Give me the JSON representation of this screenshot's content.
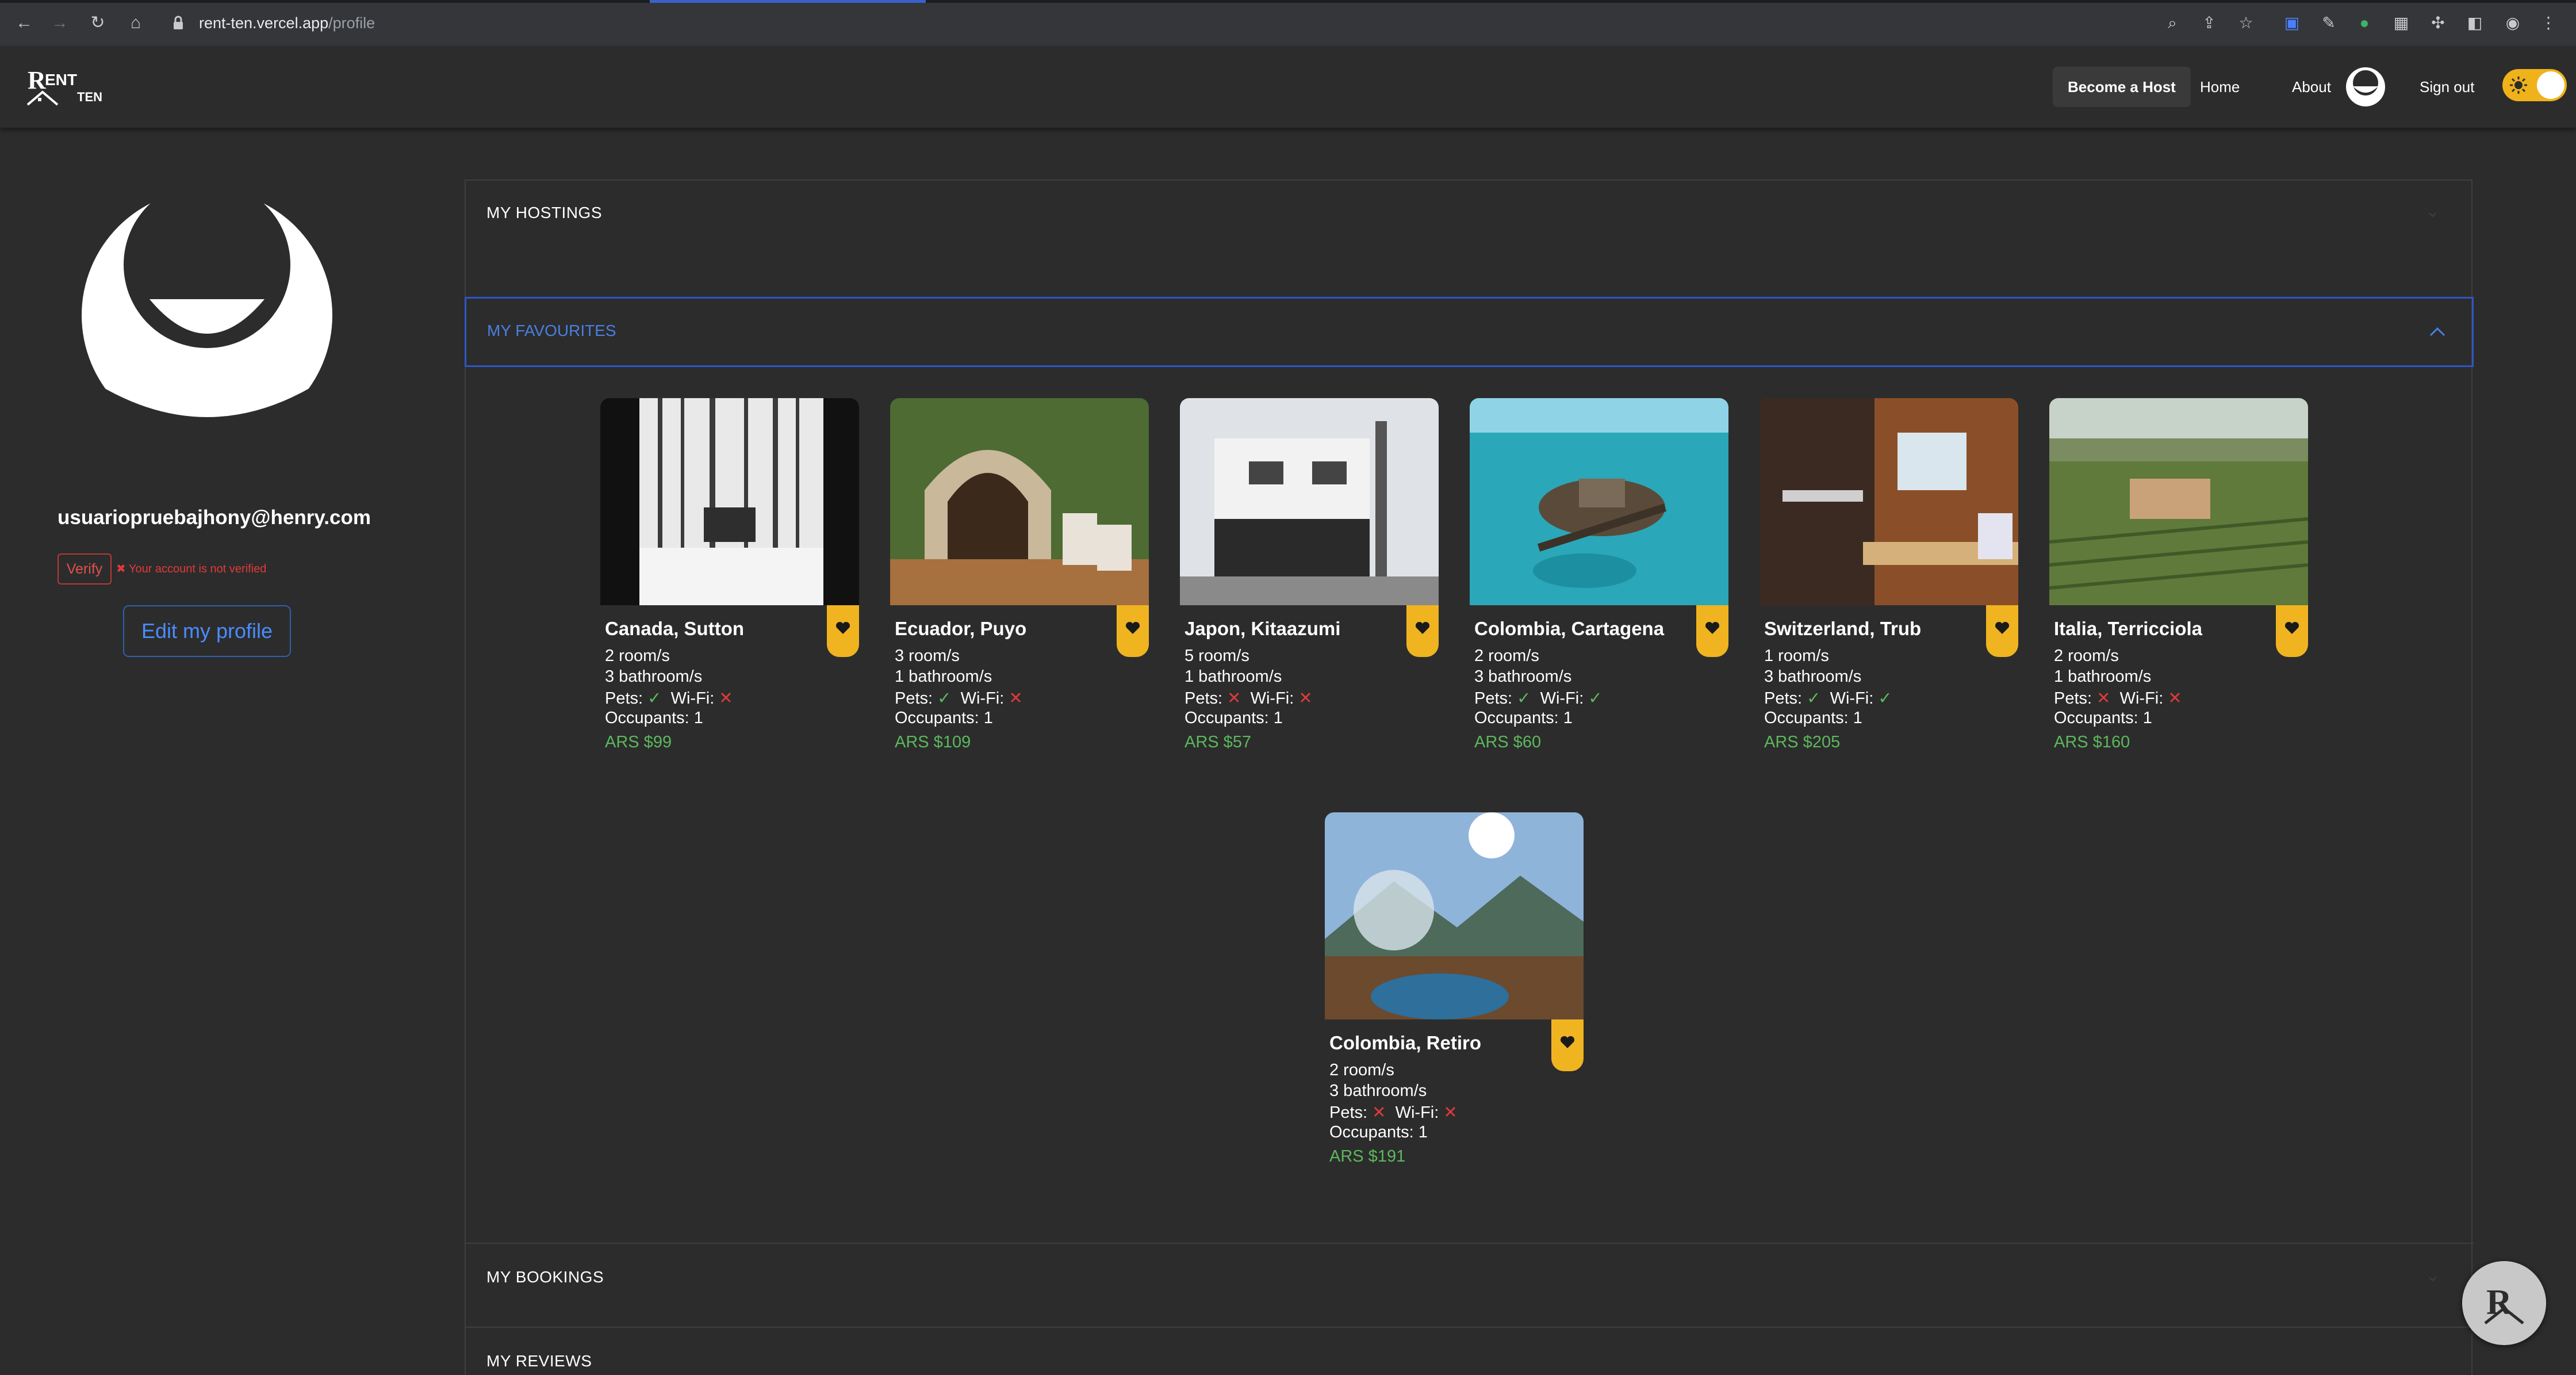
{
  "browser": {
    "url_host": "rent-ten.vercel.app",
    "url_path": "/profile"
  },
  "header": {
    "logo_text": "RENT TEN",
    "nav": {
      "become_host": "Become a Host",
      "home": "Home",
      "about": "About",
      "sign_out": "Sign out"
    }
  },
  "profile": {
    "email": "usuariopruebajhony@henry.com",
    "verify_label": "Verify",
    "verify_message": "✖ Your account is not verified",
    "edit_label": "Edit my profile"
  },
  "sections": {
    "hostings": "MY HOSTINGS",
    "favourites": "MY FAVOURITES",
    "bookings": "MY BOOKINGS",
    "reviews": "MY REVIEWS"
  },
  "favourites": [
    {
      "title": "Canada, Sutton",
      "rooms": "2 room/s",
      "baths": "3 bathroom/s",
      "pets_label": "Pets:",
      "pets": "✓",
      "wifi_label": "Wi-Fi:",
      "wifi": "✕",
      "occupants": "Occupants: 1",
      "price": "ARS $99"
    },
    {
      "title": "Ecuador, Puyo",
      "rooms": "3 room/s",
      "baths": "1 bathroom/s",
      "pets_label": "Pets:",
      "pets": "✓",
      "wifi_label": "Wi-Fi:",
      "wifi": "✕",
      "occupants": "Occupants: 1",
      "price": "ARS $109"
    },
    {
      "title": "Japon, Kitaazumi",
      "rooms": "5 room/s",
      "baths": "1 bathroom/s",
      "pets_label": "Pets:",
      "pets": "✕",
      "wifi_label": "Wi-Fi:",
      "wifi": "✕",
      "occupants": "Occupants: 1",
      "price": "ARS $57"
    },
    {
      "title": "Colombia, Cartagena",
      "rooms": "2 room/s",
      "baths": "3 bathroom/s",
      "pets_label": "Pets:",
      "pets": "✓",
      "wifi_label": "Wi-Fi:",
      "wifi": "✓",
      "occupants": "Occupants: 1",
      "price": "ARS $60"
    },
    {
      "title": "Switzerland, Trub",
      "rooms": "1 room/s",
      "baths": "3 bathroom/s",
      "pets_label": "Pets:",
      "pets": "✓",
      "wifi_label": "Wi-Fi:",
      "wifi": "✓",
      "occupants": "Occupants: 1",
      "price": "ARS $205"
    },
    {
      "title": "Italia, Terricciola",
      "rooms": "2 room/s",
      "baths": "1 bathroom/s",
      "pets_label": "Pets:",
      "pets": "✕",
      "wifi_label": "Wi-Fi:",
      "wifi": "✕",
      "occupants": "Occupants: 1",
      "price": "ARS $160"
    },
    {
      "title": "Colombia, Retiro",
      "rooms": "2 room/s",
      "baths": "3 bathroom/s",
      "pets_label": "Pets:",
      "pets": "✕",
      "wifi_label": "Wi-Fi:",
      "wifi": "✕",
      "occupants": "Occupants: 1",
      "price": "ARS $191"
    }
  ],
  "icons": {
    "favourite": "heart-icon",
    "theme": "sun-icon",
    "expand": "chevron-up-icon"
  },
  "colors": {
    "accent_blue": "#2e56c6",
    "favourite_yellow": "#f0b421",
    "price_green": "#5cb85c",
    "error_red": "#e03a3a"
  }
}
